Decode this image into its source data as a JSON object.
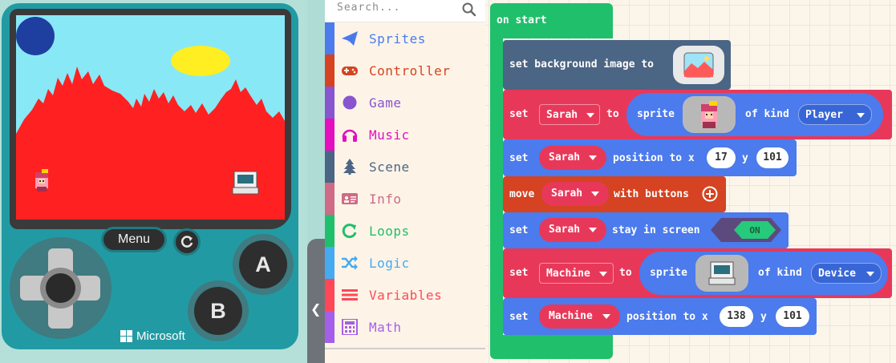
{
  "simulator": {
    "menu_label": "Menu",
    "button_a": "A",
    "button_b": "B",
    "brand": "Microsoft"
  },
  "toolbox": {
    "search_placeholder": "Search...",
    "categories": [
      {
        "label": "Sprites",
        "color": "#4b7bec",
        "icon": "paper-plane-icon"
      },
      {
        "label": "Controller",
        "color": "#d54322",
        "icon": "gamepad-icon"
      },
      {
        "label": "Game",
        "color": "#8854d0",
        "icon": "circle-icon"
      },
      {
        "label": "Music",
        "color": "#e30fc0",
        "icon": "headphones-icon"
      },
      {
        "label": "Scene",
        "color": "#4b6584",
        "icon": "tree-icon"
      },
      {
        "label": "Info",
        "color": "#cf6a87",
        "icon": "id-card-icon"
      },
      {
        "label": "Loops",
        "color": "#20bf6b",
        "icon": "refresh-icon"
      },
      {
        "label": "Logic",
        "color": "#45aaf2",
        "icon": "shuffle-icon"
      },
      {
        "label": "Variables",
        "color": "#ff4757",
        "icon": "list-icon"
      },
      {
        "label": "Math",
        "color": "#a55eea",
        "icon": "calculator-icon"
      }
    ]
  },
  "workspace": {
    "on_start": "on start",
    "background": {
      "label": "set background image to"
    },
    "set_sarah": {
      "set": "set",
      "var": "Sarah",
      "to": "to",
      "sprite": "sprite",
      "of_kind": "of kind",
      "kind": "Player"
    },
    "pos_sarah": {
      "set": "set",
      "var": "Sarah",
      "position": "position to x",
      "x": "17",
      "y_label": "y",
      "y": "101"
    },
    "move_sarah": {
      "move": "move",
      "var": "Sarah",
      "with": "with buttons"
    },
    "stay_sarah": {
      "set": "set",
      "var": "Sarah",
      "stay": "stay in screen",
      "toggle": "ON"
    },
    "set_machine": {
      "set": "set",
      "var": "Machine",
      "to": "to",
      "sprite": "sprite",
      "of_kind": "of kind",
      "kind": "Device"
    },
    "pos_machine": {
      "set": "set",
      "var": "Machine",
      "position": "position to x",
      "x": "138",
      "y_label": "y",
      "y": "101"
    }
  },
  "colors": {
    "block_sprites": "#4b7bec",
    "block_variables": "#e8385a",
    "block_controller": "#d54322",
    "block_scene": "#4b6584",
    "block_loops": "#20bf6b"
  }
}
